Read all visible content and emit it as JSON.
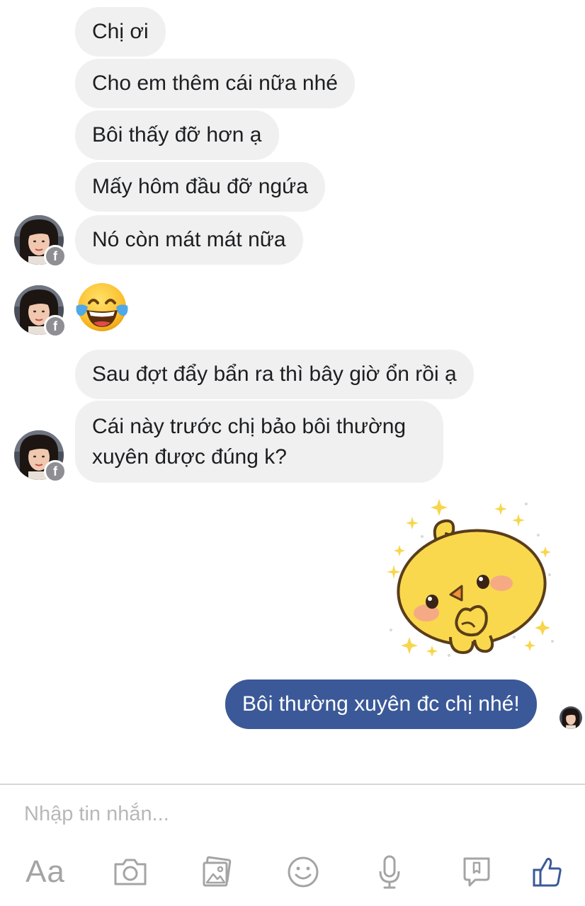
{
  "messages": {
    "m1": "Chị ơi",
    "m2": "Cho em thêm cái nữa nhé",
    "m3": "Bôi thấy đỡ hơn ạ",
    "m4": "Mấy hôm đầu đỡ ngứa",
    "m5": "Nó còn mát mát nữa",
    "m6": "Sau đợt đẩy bẩn ra thì bây giờ ổn rồi ạ",
    "m7": "Cái này trước chị bảo bôi thường xuyên được đúng k?",
    "reply": "Bôi thường xuyên đc chị nhé!"
  },
  "reactions": {
    "emoji_icon": "face-with-tears-of-joy-icon",
    "sticker_icon": "yellow-chick-sticker"
  },
  "composer": {
    "placeholder": "Nhập tin nhắn..."
  },
  "toolbar": {
    "text_label": "Aa",
    "icons": [
      "camera-icon",
      "gallery-icon",
      "smiley-icon",
      "microphone-icon",
      "sticker-icon",
      "thumbs-up-icon"
    ]
  },
  "colors": {
    "received_bubble": "#f1f0f0",
    "sent_bubble": "#3b5998",
    "like_accent": "#3b5998",
    "toolbar_icon": "#a4a4a4"
  }
}
